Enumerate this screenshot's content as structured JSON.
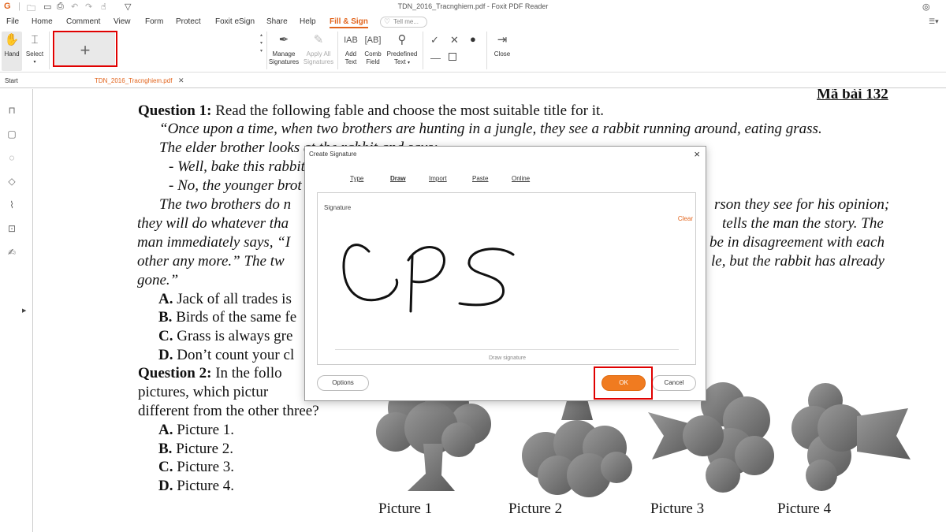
{
  "window": {
    "title": "TDN_2016_Tracnghiem.pdf - Foxit PDF Reader"
  },
  "menu": [
    "File",
    "Home",
    "Comment",
    "View",
    "Form",
    "Protect",
    "Foxit eSign",
    "Share",
    "Help",
    "Fill & Sign"
  ],
  "tell_me": "Tell me...",
  "ribbon": {
    "hand": "Hand",
    "select": "Select",
    "manage": [
      "Manage",
      "Signatures"
    ],
    "apply_all": [
      "Apply All",
      "Signatures"
    ],
    "add_text": [
      "Add",
      "Text"
    ],
    "comb_field": [
      "Comb",
      "Field"
    ],
    "predefined": [
      "Predefined",
      "Text"
    ],
    "close": "Close"
  },
  "tabs": {
    "start": "Start",
    "doc": "TDN_2016_Tracnghiem.pdf"
  },
  "document": {
    "header": "Mã bài 132",
    "q1_label": "Question 1:",
    "q1_text": " Read the following fable and choose the most suitable title for it.",
    "lines": [
      "“Once upon a time, when two brothers are hunting in a jungle, they see a rabbit running around, eating grass.",
      "The elder brother looks at the rabbit and says:",
      "- Well, bake this rabbit",
      "- No, the younger brot",
      "The two brothers do n",
      "rson they see for his opinion;",
      "they will do whatever tha",
      "tells the man the story. The",
      "man immediately says, “I",
      "be in disagreement with each",
      "other any more.”  The tw",
      "le, but the rabbit has already",
      "gone.”"
    ],
    "options_q1": [
      {
        "letter": "A.",
        "text": " Jack of all trades is"
      },
      {
        "letter": "B.",
        "text": " Birds of the same fe"
      },
      {
        "letter": "C.",
        "text": " Grass is always gre"
      },
      {
        "letter": "D.",
        "text": " Don’t count your cl"
      }
    ],
    "q2_label": "Question  2:",
    "q2_line1": "  In  the  follo",
    "q2_line2": "pictures,   which   pictur",
    "q2_line3": "different from the other three?",
    "options_q2": [
      {
        "letter": "A.",
        "text": " Picture 1."
      },
      {
        "letter": "B.",
        "text": " Picture 2."
      },
      {
        "letter": "C.",
        "text": " Picture 3."
      },
      {
        "letter": "D.",
        "text": " Picture 4."
      }
    ],
    "pictures": [
      "Picture 1",
      "Picture 2",
      "Picture 3",
      "Picture 4"
    ]
  },
  "dialog": {
    "title": "Create Signature",
    "tabs": [
      "Type",
      "Draw",
      "Import",
      "Paste",
      "Online"
    ],
    "active_tab": "Draw",
    "signature_label": "Signature",
    "clear": "Clear",
    "draw_hint": "Draw signature",
    "options": "Options",
    "ok": "OK",
    "cancel": "Cancel"
  },
  "colors": {
    "accent": "#e2641c",
    "ok_button": "#f07b20",
    "highlight": "#e00000"
  },
  "icons": [
    "foxit-logo-icon",
    "open-icon",
    "save-icon",
    "print-icon",
    "undo-icon",
    "redo-icon",
    "hand-icon",
    "select-icon",
    "add-signature-icon",
    "check-icon",
    "cross-icon",
    "dot-icon",
    "line-icon",
    "box-icon",
    "close-icon",
    "bookmark-icon",
    "pages-icon",
    "comment-icon",
    "layers-icon",
    "attachment-icon",
    "security-icon",
    "signature-panel-icon"
  ]
}
